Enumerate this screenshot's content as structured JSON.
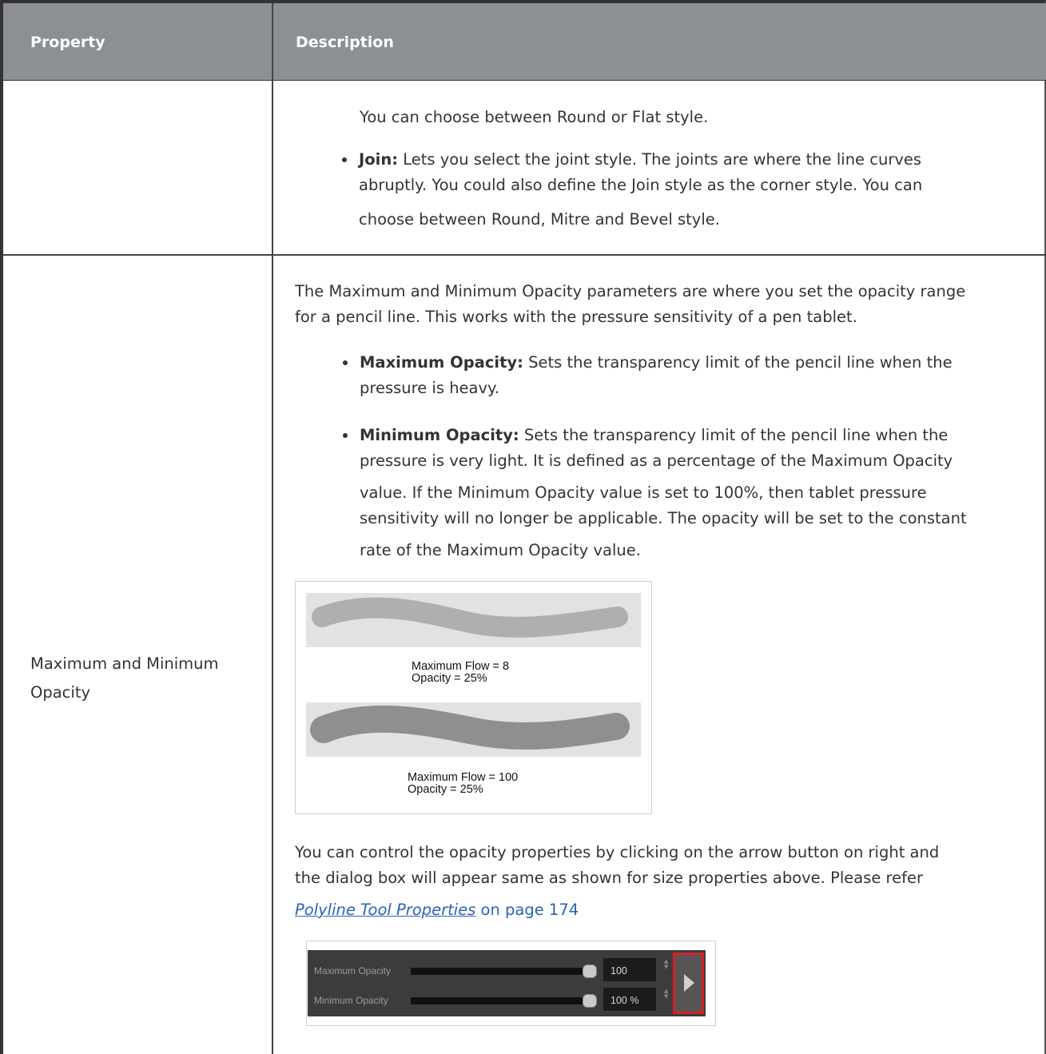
{
  "table": {
    "headers": {
      "property": "Property",
      "description": "Description"
    },
    "row1": {
      "continuation": "You can choose between Round or Flat style.",
      "join": {
        "term": "Join:",
        "line1": " Lets you select the joint style. The joints are where the line curves",
        "line2": "abruptly. You could also define the Join style as the corner style. You can",
        "line3": "choose between Round, Mitre and Bevel style."
      }
    },
    "row2": {
      "property_line1": "Maximum and Minimum",
      "property_line2": "Opacity",
      "intro_line1": "The Maximum and Minimum Opacity parameters are where you set the opacity range",
      "intro_line2": "for a pencil line. This works with the pressure sensitivity of a pen tablet.",
      "max": {
        "term": "Maximum Opacity:",
        "line1": " Sets the transparency limit of the pencil line when the",
        "line2": "pressure is heavy."
      },
      "min": {
        "term": "Minimum Opacity:",
        "line1": " Sets the transparency limit of the pencil line when the",
        "line2": "pressure is very light. It is defined as a percentage of the Maximum Opacity",
        "line3": "value. If the Minimum Opacity value is set to 100%, then tablet pressure",
        "line4": "sensitivity will no longer be applicable. The opacity will be set to the constant",
        "line5": "rate of the Maximum Opacity value."
      },
      "figure1": {
        "cap1_line1": "Maximum Flow = 8",
        "cap1_line2": "Opacity = 25%",
        "cap2_line1": "Maximum Flow = 100",
        "cap2_line2": "Opacity = 25%"
      },
      "control_line1": "You can control the opacity properties by clicking on the arrow button on right and",
      "control_line2": "the dialog box will appear same as shown for size properties above. Please refer",
      "link_text": "Polyline Tool Properties",
      "page_ref": " on page 174",
      "panel": {
        "max_label": "Maximum Opacity",
        "max_value": "100",
        "min_label": "Minimum Opacity",
        "min_value": "100 %",
        "arrow_icon": "play-right-icon"
      }
    }
  },
  "colors": {
    "header_bg": "#8c8f93",
    "link": "#2a64b3",
    "highlight": "#d81f24"
  }
}
